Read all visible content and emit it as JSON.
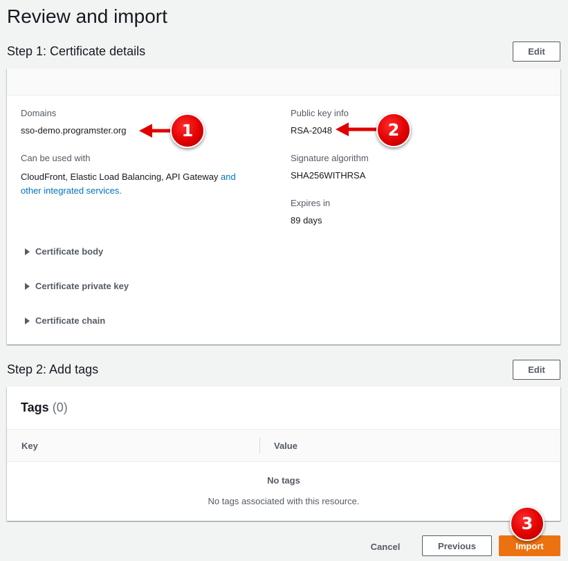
{
  "page": {
    "title": "Review and import"
  },
  "step1": {
    "title": "Step 1: Certificate details",
    "edit_label": "Edit",
    "domains_label": "Domains",
    "domains_value": "sso-demo.programster.org",
    "used_with_label": "Can be used with",
    "used_with_text": "CloudFront, Elastic Load Balancing, API Gateway ",
    "used_with_link_1": "and",
    "used_with_link_2": "other integrated services.",
    "public_key_label": "Public key info",
    "public_key_value": "RSA-2048",
    "sig_alg_label": "Signature algorithm",
    "sig_alg_value": "SHA256WITHRSA",
    "expires_label": "Expires in",
    "expires_value": "89 days",
    "expanders": [
      "Certificate body",
      "Certificate private key",
      "Certificate chain"
    ]
  },
  "step2": {
    "title": "Step 2: Add tags",
    "edit_label": "Edit",
    "tags_title": "Tags",
    "tags_count": "(0)",
    "columns": [
      "Key",
      "Value"
    ],
    "empty_title": "No tags",
    "empty_desc": "No tags associated with this resource."
  },
  "footer": {
    "cancel": "Cancel",
    "previous": "Previous",
    "import": "Import"
  },
  "annotations": [
    "1",
    "2",
    "3"
  ],
  "colors": {
    "accent": "#ec7211",
    "link": "#0073bb",
    "annotation": "#e00000"
  }
}
